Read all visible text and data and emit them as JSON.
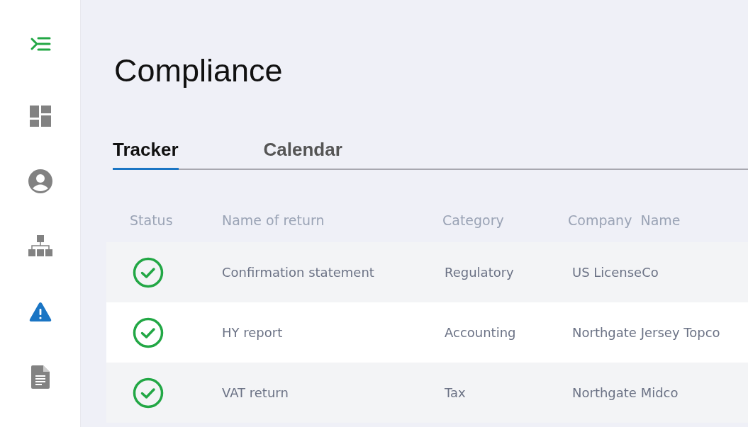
{
  "sidebar": {
    "toggle": {
      "kind": "menu"
    },
    "items": [
      {
        "kind": "dashboard",
        "selected": false
      },
      {
        "kind": "profile",
        "selected": false
      },
      {
        "kind": "hierarchy",
        "selected": false
      },
      {
        "kind": "alert",
        "selected": true
      },
      {
        "kind": "document",
        "selected": false
      }
    ]
  },
  "page": {
    "title": "Compliance"
  },
  "tabs": [
    {
      "label": "Tracker",
      "selected": true
    },
    {
      "label": "Calendar",
      "selected": false
    }
  ],
  "table": {
    "columns": [
      "Status",
      "Name of return",
      "Category",
      "Company  Name"
    ],
    "rows": [
      {
        "complete": true,
        "name": "Confirmation statement",
        "category": "Regulatory",
        "company": "US LicenseCo"
      },
      {
        "complete": true,
        "name": "HY report",
        "category": "Accounting",
        "company": "Northgate Jersey Topco"
      },
      {
        "complete": true,
        "name": "VAT return",
        "category": "Tax",
        "company": "Northgate Midco"
      }
    ]
  }
}
